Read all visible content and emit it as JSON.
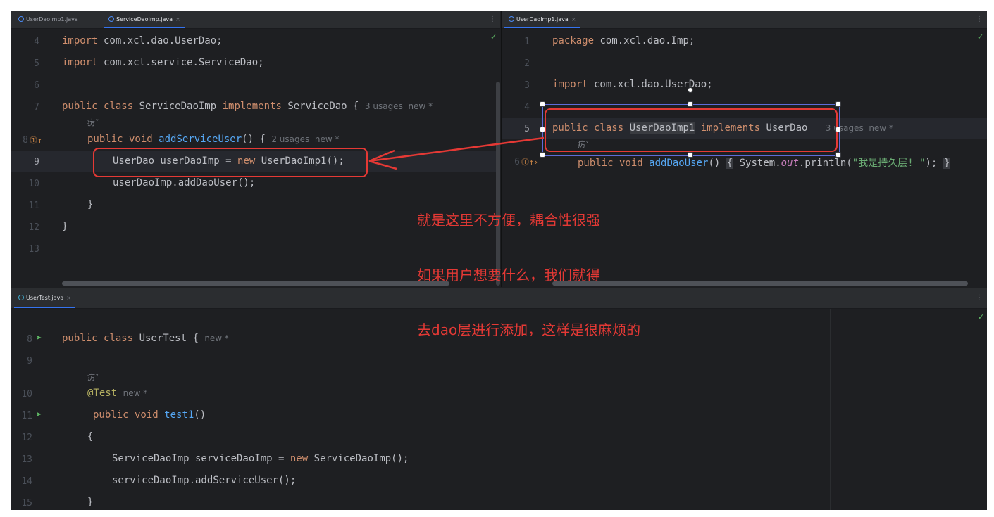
{
  "top_left": {
    "tabs": [
      {
        "label": "UserDaoImp1.java",
        "active": false
      },
      {
        "label": "ServiceDaoImp.java",
        "active": true,
        "close": "×"
      }
    ],
    "line_numbers": [
      "4",
      "5",
      "6",
      "7",
      "8",
      "9",
      "10",
      "11",
      "12",
      "13"
    ],
    "lines": {
      "l4_kw": "import",
      "l4_rest": " com.xcl.dao.UserDao;",
      "l5_kw": "import",
      "l5_rest": " com.xcl.service.ServiceDao;",
      "l7_kw1": "public class",
      "l7_name": " ServiceDaoImp ",
      "l7_kw2": "implements",
      "l7_rest": " ServiceDao {",
      "l7_hint": "3 usages  new *",
      "l8_kw": "public void ",
      "l8_fn": "addServiceUser",
      "l8_rest": "() {",
      "l8_hint": "2 usages  new *",
      "l9_a": "UserDao userDaoImp = ",
      "l9_kw": "new",
      "l9_b": " UserDaoImp1();",
      "l10": "userDaoImp.addDaoUser();",
      "l11": "}",
      "l12": "}"
    }
  },
  "top_right": {
    "tabs": [
      {
        "label": "UserDaoImp1.java",
        "active": true,
        "close": "×"
      }
    ],
    "line_numbers": [
      "1",
      "2",
      "3",
      "4",
      "5",
      "6"
    ],
    "lines": {
      "l1_kw": "package",
      "l1_rest": " com.xcl.dao.Imp;",
      "l3_kw": "import",
      "l3_rest": " com.xcl.dao.UserDao;",
      "l5_kw1": "public class",
      "l5_name": "UserDaoImp1",
      "l5_kw2": "implements",
      "l5_rest": " UserDao",
      "l5_hint": "3 usages  new *",
      "l6_kw": "public void ",
      "l6_fn": "addDaoUser",
      "l6_a": "() ",
      "l6_b": "{",
      "l6_c": " System.",
      "l6_out": "out",
      "l6_d": ".println(",
      "l6_str": "\"我是持久层! \"",
      "l6_e": "); ",
      "l6_f": "}"
    }
  },
  "bottom": {
    "tabs": [
      {
        "label": "UserTest.java",
        "active": true,
        "close": "×"
      }
    ],
    "line_numbers": [
      "8",
      "9",
      "10",
      "11",
      "12",
      "13",
      "14",
      "15"
    ],
    "lines": {
      "l8_kw": "public class",
      "l8_rest": " UserTest {",
      "l8_hint": "new *",
      "l10_ann": "@Test",
      "l10_hint": "new *",
      "l11_kw": "public void ",
      "l11_fn": "test1",
      "l11_rest": "()",
      "l12": "{",
      "l13_a": "ServiceDaoImp serviceDaoImp = ",
      "l13_kw": "new",
      "l13_b": " ServiceDaoImp();",
      "l14": "serviceDaoImp.addServiceUser();",
      "l15": "}"
    }
  },
  "annotation": {
    "line1": "就是这里不方便，耦合性很强",
    "line2": "如果用户想要什么，我们就得",
    "line3": "去dao层进行添加，这样是很麻烦的",
    "color": "#e53935"
  },
  "icons": {
    "tab_menu": "⋮",
    "check": "✓",
    "agent": "疠˅",
    "run_test": "run-test-icon",
    "implements": "implements-icon"
  }
}
